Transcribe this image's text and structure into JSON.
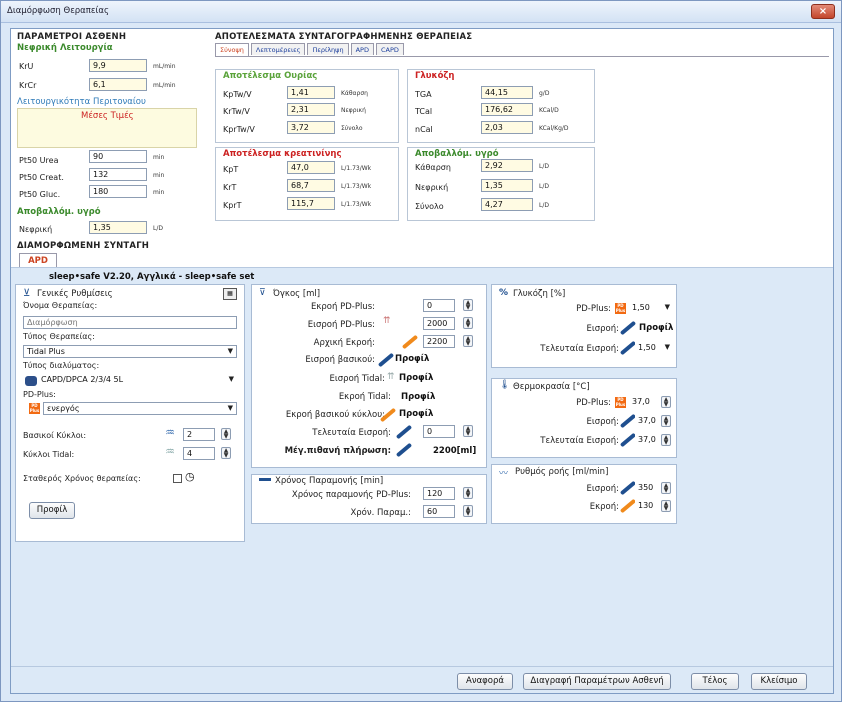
{
  "window": {
    "title": "Διαμόρφωση Θεραπείας",
    "close": "×"
  },
  "patient": {
    "title": "ΠΑΡΑΜΕΤΡΟΙ ΑΣΘΕΝΗ",
    "renal_title": "Νεφρική Λειτουργία",
    "krU_label": "KrU",
    "krU_value": "9,9",
    "krU_unit": "mL/min",
    "krCr_label": "KrCr",
    "krCr_value": "6,1",
    "krCr_unit": "mL/min",
    "peritoneal_title": "Λειτουργικότητα Περιτοναίου",
    "mean_values": "Μέσες Τιμές",
    "pt50urea_label": "Pt50 Urea",
    "pt50urea_value": "90",
    "pt50urea_unit": "min",
    "pt50creat_label": "Pt50 Creat.",
    "pt50creat_value": "132",
    "pt50creat_unit": "min",
    "pt50gluc_label": "Pt50 Gluc.",
    "pt50gluc_value": "180",
    "pt50gluc_unit": "min",
    "fluid_title": "Αποβαλλόμ. υγρό",
    "renal_fluid_label": "Νεφρική",
    "renal_fluid_value": "1,35",
    "renal_fluid_unit": "L/D"
  },
  "results": {
    "title": "ΑΠΟΤΕΛΕΣΜΑΤΑ ΣΥΝΤΑΓΟΓΡΑΦΗΜΕΝΗΣ ΘΕΡΑΠΕΙΑΣ",
    "tabs": [
      "Σύνοψη",
      "Λεπτομέρειες",
      "Περίληψη",
      "APD",
      "CAPD"
    ],
    "urea_title": "Αποτέλεσμα Ουρίας",
    "urea": [
      {
        "label": "KpTw/V",
        "value": "1,41",
        "unit": "Κάθαρση"
      },
      {
        "label": "KrTw/V",
        "value": "2,31",
        "unit": "Νεφρική"
      },
      {
        "label": "KprTw/V",
        "value": "3,72",
        "unit": "Σύνολο"
      }
    ],
    "gluc_title": "Γλυκόζη",
    "gluc": [
      {
        "label": "TGA",
        "value": "44,15",
        "unit": "g/D"
      },
      {
        "label": "TCal",
        "value": "176,62",
        "unit": "KCal/D"
      },
      {
        "label": "nCal",
        "value": "2,03",
        "unit": "KCal/Kg/D"
      }
    ],
    "creat_title": "Αποτέλεσμα κρεατινίνης",
    "creat": [
      {
        "label": "KpT",
        "value": "47,0",
        "unit": "L/1.73/Wk"
      },
      {
        "label": "KrT",
        "value": "68,7",
        "unit": "L/1.73/Wk"
      },
      {
        "label": "KprT",
        "value": "115,7",
        "unit": "L/1.73/Wk"
      }
    ],
    "fluid_title": "Αποβαλλόμ. υγρό",
    "fluid": [
      {
        "label": "Κάθαρση",
        "value": "2,92",
        "unit": "L/D"
      },
      {
        "label": "Νεφρική",
        "value": "1,35",
        "unit": "L/D"
      },
      {
        "label": "Σύνολο",
        "value": "4,27",
        "unit": "L/D"
      }
    ]
  },
  "prescription": {
    "title": "ΔΙΑΜΟΡΦΩΜΕΝΗ ΣΥΝΤΑΓΗ",
    "tab": "APD",
    "device": "sleep•safe V2.20, Αγγλικά - sleep•safe set"
  },
  "general": {
    "title": "Γενικές Ρυθμίσεις",
    "name_label": "Όνομα Θεραπείας:",
    "name_placeholder": "Διαμόρφωση",
    "type_label": "Τύπος Θεραπείας:",
    "type_value": "Tidal Plus",
    "solution_label": "Τύπος διαλύματος:",
    "solution_value": "CAPD/DPCA 2/3/4 5L",
    "pdplus_label": "PD-Plus:",
    "pdplus_value": "ενεργός",
    "basic_cycles_label": "Βασικοί Κύκλοι:",
    "basic_cycles_value": "2",
    "tidal_cycles_label": "Κύκλοι Tidal:",
    "tidal_cycles_value": "4",
    "fixed_time_label": "Σταθερός Χρόνος θεραπείας:",
    "profile_button": "Προφίλ"
  },
  "volume": {
    "title": "Όγκος [ml]",
    "rows": [
      {
        "label": "Εκροή PD-Plus:",
        "value": "0"
      },
      {
        "label": "Εισροή PD-Plus:",
        "value": "2000"
      },
      {
        "label": "Αρχική Εκροή:",
        "value": "2200"
      },
      {
        "label": "Εισροή βασικού:",
        "value": "Προφίλ"
      },
      {
        "label": "Εισροή Tidal:",
        "value": "Προφίλ"
      },
      {
        "label": "Εκροή Tidal:",
        "value": "Προφίλ"
      },
      {
        "label": "Εκροή βασικού κύκλου:",
        "value": "Προφίλ"
      },
      {
        "label": "Τελευταία Εισροή:",
        "value": "0"
      }
    ],
    "max_label": "Μέγ.πιθανή πλήρωση:",
    "max_value": "2200[ml]"
  },
  "dwell": {
    "title": "Χρόνος Παραμονής [min]",
    "pdplus_label": "Χρόνος παραμονής PD-Plus:",
    "pdplus_value": "120",
    "param_label": "Χρόν. Παραμ.:",
    "param_value": "60"
  },
  "glucose": {
    "title": "Γλυκόζη [%]",
    "pdplus_label": "PD-Plus:",
    "pdplus_value": "1,50",
    "inflow_label": "Εισροή:",
    "inflow_value": "Προφίλ",
    "last_label": "Τελευταία Εισροή:",
    "last_value": "1,50"
  },
  "temperature": {
    "title": "Θερμοκρασία [°C]",
    "pdplus_label": "PD-Plus:",
    "pdplus_value": "37,0",
    "inflow_label": "Εισροή:",
    "inflow_value": "37,0",
    "last_label": "Τελευταία Εισροή:",
    "last_value": "37,0"
  },
  "flow": {
    "title": "Ρυθμός ροής [ml/min]",
    "in_label": "Εισροή:",
    "in_value": "350",
    "out_label": "Εκροή:",
    "out_value": "130"
  },
  "footer": {
    "report": "Αναφορά",
    "delete": "Διαγραφή Παραμέτρων Ασθενή",
    "finish": "Τέλος",
    "close": "Κλείσιμο"
  },
  "pp_badge": "PD Plus"
}
